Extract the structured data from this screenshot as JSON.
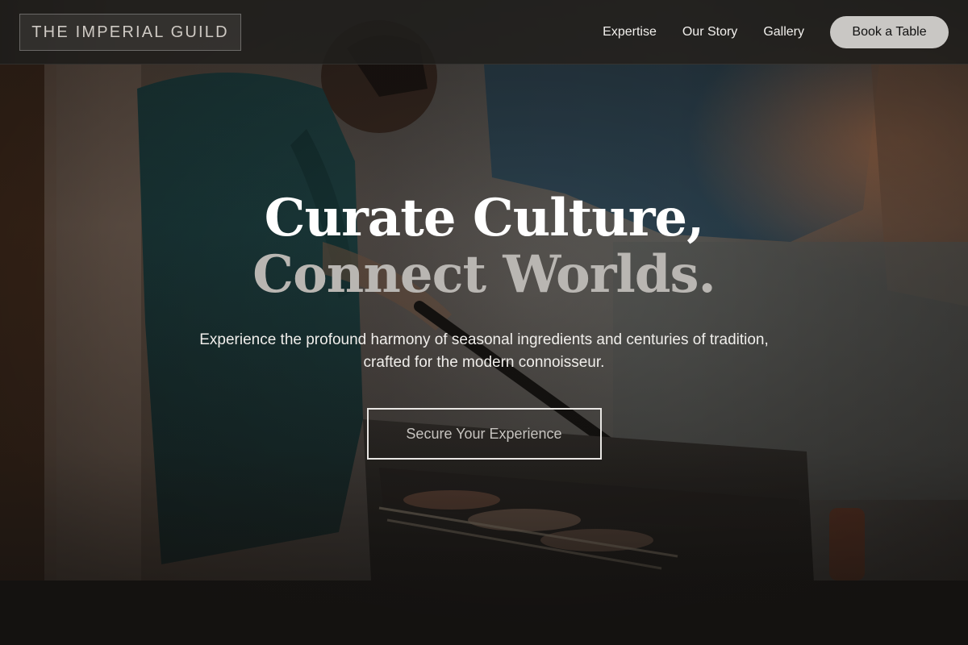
{
  "brand": {
    "name": "THE IMPERIAL GUILD"
  },
  "nav": {
    "links": [
      "Expertise",
      "Our Story",
      "Gallery"
    ],
    "book_label": "Book a Table"
  },
  "hero": {
    "headline_line1": "Curate Culture,",
    "headline_line2": "Connect Worlds.",
    "subtitle_line1": "Experience the profound harmony of seasonal ingredients and centuries of tradition,",
    "subtitle_line2": "crafted for the modern connoisseur.",
    "cta_label": "Secure Your Experience",
    "background_image": "chef-grilling-skewers-photo"
  },
  "colors": {
    "header_bg": "#201e1c",
    "book_button_bg": "#c9c7c4",
    "headline_primary": "#ffffff",
    "headline_secondary": "#b9b6b2"
  }
}
